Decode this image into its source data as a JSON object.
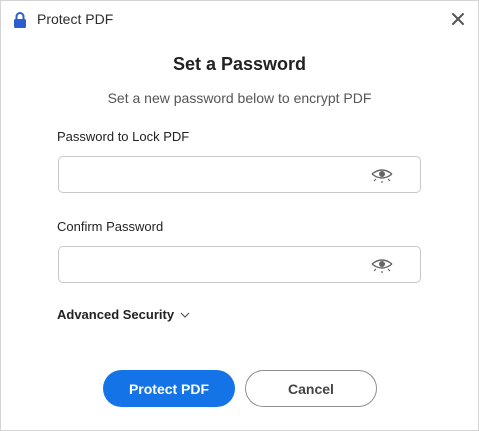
{
  "window": {
    "title": "Protect PDF"
  },
  "dialog": {
    "heading": "Set a Password",
    "subheading": "Set a new password below to encrypt PDF",
    "password_label": "Password to Lock PDF",
    "password_value": "",
    "confirm_label": "Confirm Password",
    "confirm_value": "",
    "advanced_label": "Advanced Security",
    "protect_button": "Protect PDF",
    "cancel_button": "Cancel"
  },
  "icons": {
    "title_icon": "lock-icon",
    "close_icon": "close-icon",
    "reveal_icon": "eye-icon",
    "advanced_icon": "chevron-down-icon"
  },
  "colors": {
    "accent": "#1473e6",
    "lock_icon": "#2b5ecb"
  }
}
